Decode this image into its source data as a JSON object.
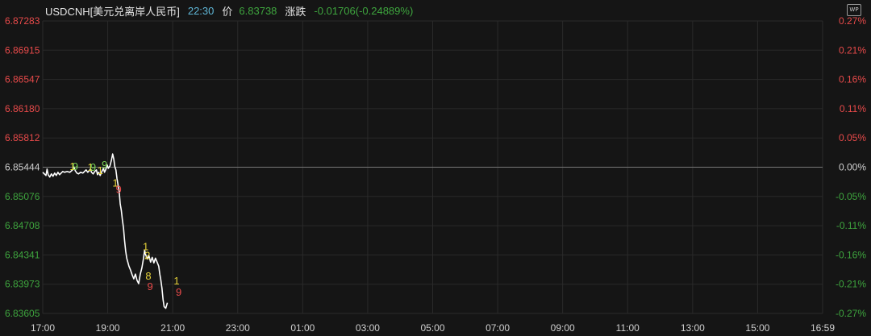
{
  "header": {
    "symbol": "USDCNH[美元兑离岸人民币]",
    "time": "22:30",
    "price_label": "价",
    "price": "6.83738",
    "change_label": "涨跌",
    "change": "-0.01706(-0.24889%)",
    "badge": "WP"
  },
  "chart_data": {
    "type": "line",
    "base_price": 6.85444,
    "y_ticks_left": [
      "6.87283",
      "6.86915",
      "6.86547",
      "6.86180",
      "6.85812",
      "6.85444",
      "6.85076",
      "6.84708",
      "6.84341",
      "6.83973",
      "6.83605"
    ],
    "y_ticks_right": [
      "0.27%",
      "0.21%",
      "0.16%",
      "0.11%",
      "0.05%",
      "0.00%",
      "-0.05%",
      "-0.11%",
      "-0.16%",
      "-0.21%",
      "-0.27%"
    ],
    "ylim": [
      6.83605,
      6.87283
    ],
    "x_ticks": [
      "17:00",
      "19:00",
      "21:00",
      "23:00",
      "01:00",
      "03:00",
      "05:00",
      "07:00",
      "09:00",
      "11:00",
      "13:00",
      "15:00",
      "16:59"
    ],
    "x_range_minutes": [
      0,
      1439
    ],
    "series": [
      {
        "points": [
          [
            0,
            6.8538
          ],
          [
            3,
            6.8536
          ],
          [
            6,
            6.8534
          ],
          [
            8,
            6.8542
          ],
          [
            10,
            6.8535
          ],
          [
            13,
            6.8532
          ],
          [
            16,
            6.8536
          ],
          [
            19,
            6.8533
          ],
          [
            22,
            6.8537
          ],
          [
            25,
            6.8534
          ],
          [
            28,
            6.8538
          ],
          [
            31,
            6.8535
          ],
          [
            34,
            6.8537
          ],
          [
            37,
            6.8539
          ],
          [
            40,
            6.8538
          ],
          [
            45,
            6.8539
          ],
          [
            50,
            6.8538
          ],
          [
            55,
            6.8541
          ],
          [
            58,
            6.8544
          ],
          [
            60,
            6.854
          ],
          [
            63,
            6.8537
          ],
          [
            66,
            6.8536
          ],
          [
            70,
            6.8538
          ],
          [
            74,
            6.8537
          ],
          [
            77,
            6.8539
          ],
          [
            80,
            6.8541
          ],
          [
            83,
            6.8538
          ],
          [
            86,
            6.854
          ],
          [
            88,
            6.8542
          ],
          [
            90,
            6.8538
          ],
          [
            93,
            6.8536
          ],
          [
            96,
            6.8539
          ],
          [
            99,
            6.8541
          ],
          [
            101,
            6.8535
          ],
          [
            103,
            6.8538
          ],
          [
            106,
            6.8534
          ],
          [
            109,
            6.8539
          ],
          [
            112,
            6.8543
          ],
          [
            114,
            6.8538
          ],
          [
            116,
            6.8541
          ],
          [
            119,
            6.8547
          ],
          [
            121,
            6.8543
          ],
          [
            124,
            6.8546
          ],
          [
            127,
            6.8554
          ],
          [
            129,
            6.8561
          ],
          [
            131,
            6.8555
          ],
          [
            133,
            6.8545
          ],
          [
            135,
            6.8541
          ],
          [
            137,
            6.853
          ],
          [
            139,
            6.8522
          ],
          [
            141,
            6.8514
          ],
          [
            143,
            6.8498
          ],
          [
            145,
            6.849
          ],
          [
            147,
            6.8478
          ],
          [
            149,
            6.8468
          ],
          [
            151,
            6.8452
          ],
          [
            153,
            6.8439
          ],
          [
            155,
            6.843
          ],
          [
            157,
            6.8425
          ],
          [
            159,
            6.842
          ],
          [
            162,
            6.8415
          ],
          [
            165,
            6.8409
          ],
          [
            168,
            6.8404
          ],
          [
            171,
            6.841
          ],
          [
            174,
            6.8402
          ],
          [
            177,
            6.8398
          ],
          [
            180,
            6.841
          ],
          [
            183,
            6.8418
          ],
          [
            186,
            6.843
          ],
          [
            188,
            6.844
          ],
          [
            190,
            6.8434
          ],
          [
            193,
            6.8429
          ],
          [
            196,
            6.8433
          ],
          [
            199,
            6.8425
          ],
          [
            202,
            6.8431
          ],
          [
            205,
            6.8424
          ],
          [
            208,
            6.843
          ],
          [
            211,
            6.8425
          ],
          [
            214,
            6.842
          ],
          [
            216,
            6.841
          ],
          [
            218,
            6.8402
          ],
          [
            220,
            6.8392
          ],
          [
            222,
            6.8378
          ],
          [
            224,
            6.8369
          ],
          [
            227,
            6.8367
          ],
          [
            230,
            6.8374
          ]
        ]
      }
    ],
    "annotations": [
      {
        "text": "1",
        "t": 55,
        "y": 6.8546,
        "color": "#e6d23a"
      },
      {
        "text": "9",
        "t": 60,
        "y": 6.8546,
        "color": "#7ed957"
      },
      {
        "text": "1",
        "t": 88,
        "y": 6.8545,
        "color": "#e6d23a"
      },
      {
        "text": "9",
        "t": 93,
        "y": 6.8545,
        "color": "#7ed957"
      },
      {
        "text": "1",
        "t": 106,
        "y": 6.8541,
        "color": "#e6d23a"
      },
      {
        "text": "9",
        "t": 114,
        "y": 6.8548,
        "color": "#7ed957"
      },
      {
        "text": "1",
        "t": 134,
        "y": 6.8525,
        "color": "#e6d23a"
      },
      {
        "text": "9",
        "t": 140,
        "y": 6.8517,
        "color": "#e84a4a"
      },
      {
        "text": "1",
        "t": 190,
        "y": 6.8445,
        "color": "#e6d23a"
      },
      {
        "text": "2",
        "t": 193,
        "y": 6.8434,
        "color": "#e6d23a"
      },
      {
        "text": "8",
        "t": 195,
        "y": 6.8408,
        "color": "#e6d23a"
      },
      {
        "text": "9",
        "t": 198,
        "y": 6.8395,
        "color": "#e84a4a"
      },
      {
        "text": "1",
        "t": 247,
        "y": 6.8402,
        "color": "#e6d23a"
      },
      {
        "text": "9",
        "t": 251,
        "y": 6.8388,
        "color": "#e84a4a"
      }
    ],
    "colors": {
      "up": "#e84a4a",
      "down": "#3ea53e",
      "neutral": "#cfcfcf",
      "line": "#ffffff",
      "grid": "#2a2a2a",
      "baseline": "#777777"
    }
  }
}
